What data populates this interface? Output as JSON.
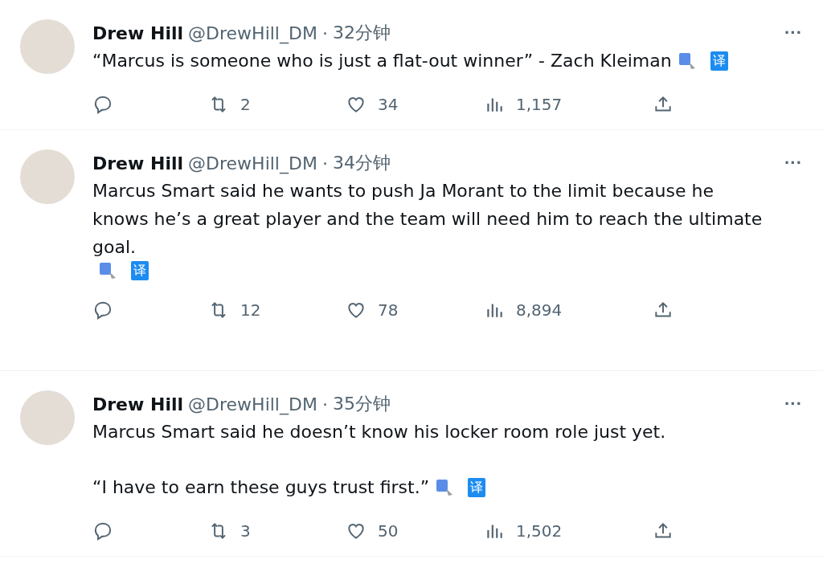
{
  "tweets": [
    {
      "name": "Drew Hill",
      "handle": "@DrewHill_DM",
      "separator": "·",
      "time": "32分钟",
      "more": "···",
      "paragraphs": [
        "“Marcus is someone who is just a flat-out winner” - Zach Kleiman"
      ],
      "translate_badge": "译",
      "retweets": "2",
      "likes": "34",
      "views": "1,157",
      "gap_after": false
    },
    {
      "name": "Drew Hill",
      "handle": "@DrewHill_DM",
      "separator": "·",
      "time": "34分钟",
      "more": "···",
      "paragraphs": [
        "Marcus Smart said he wants to push Ja Morant to the limit because he knows he’s a great player and the team will need him to reach the ultimate goal."
      ],
      "translate_badge": "译",
      "retweets": "12",
      "likes": "78",
      "views": "8,894",
      "gap_after": true
    },
    {
      "name": "Drew Hill",
      "handle": "@DrewHill_DM",
      "separator": "·",
      "time": "35分钟",
      "more": "···",
      "paragraphs": [
        "Marcus Smart said he doesn’t know his locker room role just yet.",
        "“I have to earn these guys trust first.”"
      ],
      "translate_badge": "译",
      "retweets": "3",
      "likes": "50",
      "views": "1,502",
      "gap_after": false
    }
  ]
}
